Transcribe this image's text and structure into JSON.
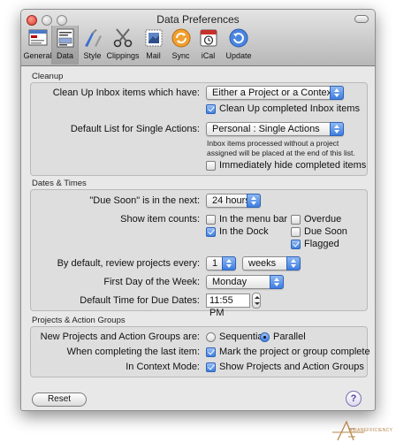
{
  "window": {
    "title": "Data Preferences"
  },
  "toolbar": {
    "items": [
      {
        "label": "General",
        "icon": "general-prefs-icon",
        "selected": false
      },
      {
        "label": "Data",
        "icon": "data-prefs-icon",
        "selected": true
      },
      {
        "label": "Style",
        "icon": "style-brush-icon",
        "selected": false
      },
      {
        "label": "Clippings",
        "icon": "scissors-icon",
        "selected": false
      },
      {
        "label": "Mail",
        "icon": "mail-stamp-icon",
        "selected": false
      },
      {
        "label": "Sync",
        "icon": "sync-icon",
        "selected": false
      },
      {
        "label": "iCal",
        "icon": "ical-icon",
        "selected": false
      },
      {
        "label": "Update",
        "icon": "update-icon",
        "selected": false
      }
    ]
  },
  "cleanup": {
    "section_title": "Cleanup",
    "inbox_label": "Clean Up Inbox items which have:",
    "inbox_value": "Either a Project or a Context",
    "completed_checkbox": "Clean Up completed Inbox items",
    "completed_checked": true,
    "default_list_label": "Default List for Single Actions:",
    "default_list_value": "Personal : Single Actions",
    "note_line1": "Inbox items processed without a project",
    "note_line2": "assigned will be placed at the end of this list.",
    "hide_checkbox": "Immediately hide completed items",
    "hide_checked": false
  },
  "dates": {
    "section_title": "Dates & Times",
    "due_soon_label": "\"Due Soon\" is in the next:",
    "due_soon_value": "24 hours",
    "show_counts_label": "Show item counts:",
    "counts": [
      {
        "label": "In the menu bar",
        "checked": false
      },
      {
        "label": "Overdue",
        "checked": false
      },
      {
        "label": "In the Dock",
        "checked": true
      },
      {
        "label": "Due Soon",
        "checked": false
      },
      {
        "label": "Flagged",
        "checked": true
      }
    ],
    "review_label": "By default, review projects every:",
    "review_number": "1",
    "review_unit": "weeks",
    "first_day_label": "First Day of the Week:",
    "first_day_value": "Monday",
    "default_time_label": "Default Time for Due Dates:",
    "default_time_value": "11:55 PM"
  },
  "projects": {
    "section_title": "Projects & Action Groups",
    "new_are_label": "New Projects and Action Groups are:",
    "sequential_label": "Sequential",
    "parallel_label": "Parallel",
    "selected": "Parallel",
    "completing_label": "When completing the last item:",
    "completing_checkbox": "Mark the project or group complete",
    "completing_checked": true,
    "context_mode_label": "In Context Mode:",
    "context_mode_checkbox": "Show Projects and Action Groups",
    "context_mode_checked": true
  },
  "footer": {
    "reset_label": "Reset",
    "help_label": "?"
  },
  "watermark": {
    "text": "ASIANEFFICIENCY"
  },
  "colors": {
    "accent": "#3d7ee0",
    "window_bg": "#e8e8e8",
    "group_bg": "#dedede"
  }
}
